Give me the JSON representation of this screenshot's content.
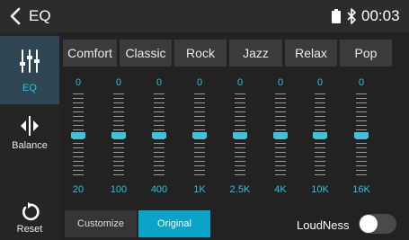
{
  "colors": {
    "accent": "#25c4e3",
    "background": "#222222",
    "active_button": "#0aa4c9"
  },
  "header": {
    "title": "EQ",
    "time": "00:03",
    "icons": [
      "chevron-left-icon",
      "battery-icon",
      "bluetooth-icon"
    ]
  },
  "sidebar": {
    "items": [
      {
        "label": "EQ",
        "icon": "equalizer-icon",
        "active": true
      },
      {
        "label": "Balance",
        "icon": "balance-icon",
        "active": false
      },
      {
        "label": "Reset",
        "icon": "reset-icon",
        "active": false
      }
    ]
  },
  "presets": [
    "Comfort",
    "Classic",
    "Rock",
    "Jazz",
    "Relax",
    "Pop"
  ],
  "bands": [
    {
      "freq": "20",
      "gain": "0"
    },
    {
      "freq": "100",
      "gain": "0"
    },
    {
      "freq": "400",
      "gain": "0"
    },
    {
      "freq": "1K",
      "gain": "0"
    },
    {
      "freq": "2.5K",
      "gain": "0"
    },
    {
      "freq": "4K",
      "gain": "0"
    },
    {
      "freq": "10K",
      "gain": "0"
    },
    {
      "freq": "16K",
      "gain": "0"
    }
  ],
  "bottom": {
    "customize": "Customize",
    "original": "Original",
    "loudness_label": "LoudNess",
    "loudness_on": false
  }
}
